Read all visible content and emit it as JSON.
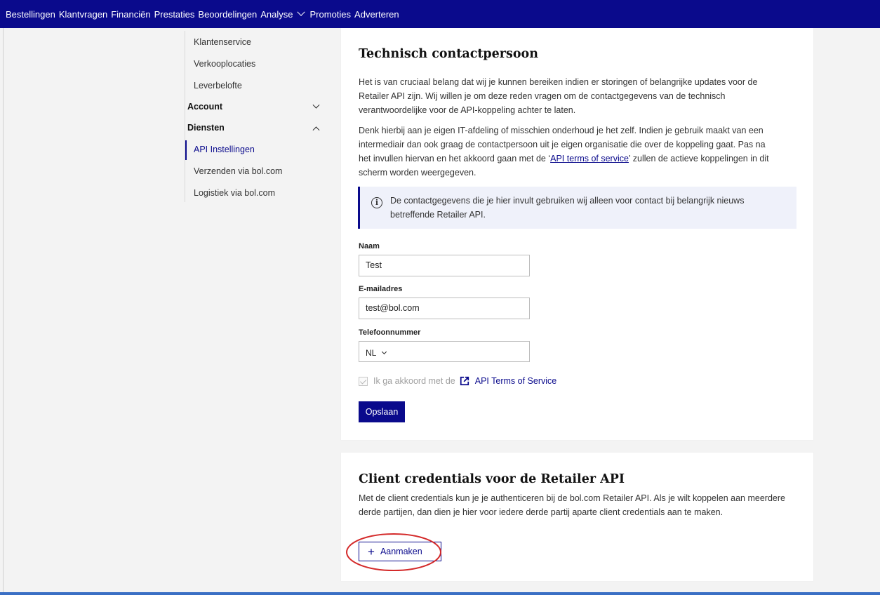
{
  "topnav": {
    "items": [
      "Bestellingen",
      "Klantvragen",
      "Financiën",
      "Prestaties",
      "Beoordelingen",
      "Analyse",
      "Promoties",
      "Adverteren"
    ]
  },
  "sidebar": {
    "items_top": [
      "Klantenservice",
      "Verkooplocaties",
      "Leverbelofte"
    ],
    "account_label": "Account",
    "diensten_label": "Diensten",
    "diensten_items": [
      "API Instellingen",
      "Verzenden via bol.com",
      "Logistiek via bol.com"
    ]
  },
  "contact": {
    "title": "Technisch contactpersoon",
    "para1": "Het is van cruciaal belang dat wij je kunnen bereiken indien er storingen of belangrijke updates voor de Retailer API zijn. Wij willen je om deze reden vragen om de contactgegevens van de technisch verantwoordelijke voor de API-koppeling achter te laten.",
    "para2_before": "Denk hierbij aan je eigen IT-afdeling of misschien onderhoud je het zelf. Indien je gebruik maakt van een intermediair dan ook graag de contactpersoon uit je eigen organisatie die over de koppeling gaat. Pas na het invullen hiervan en het akkoord gaan met de ‘",
    "para2_link": "API terms of service",
    "para2_after": "’ zullen de actieve koppelingen in dit scherm worden weergegeven.",
    "info_text": "De contactgegevens die je hier invult gebruiken wij alleen voor contact bij belangrijk nieuws betreffende Retailer API.",
    "name_label": "Naam",
    "name_value": "Test",
    "email_label": "E-mailadres",
    "email_value": "test@bol.com",
    "phone_label": "Telefoonnummer",
    "phone_country": "NL",
    "agree_text": "Ik ga akkoord met de",
    "agree_link": "API Terms of Service",
    "save_label": "Opslaan"
  },
  "credentials": {
    "title": "Client credentials voor de Retailer API",
    "para": "Met de client credentials kun je je authenticeren bij de bol.com Retailer API. Als je wilt koppelen aan meerdere derde partijen, dan dien je hier voor iedere derde partij aparte client credentials aan te maken.",
    "create_label": "Aanmaken"
  },
  "colors": {
    "brand": "#0a0a8c",
    "annotation": "#d42a2a"
  }
}
